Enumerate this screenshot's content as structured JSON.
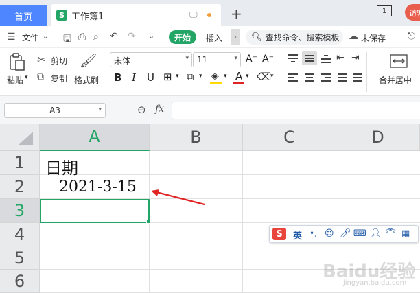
{
  "tabs": {
    "home_label": "首页",
    "doc_icon_letter": "S",
    "doc_title": "工作簿1",
    "page_indicator": "1",
    "visitor_label": "访客"
  },
  "menu": {
    "file_label": "文件",
    "start_label": "开始",
    "insert_label": "插入",
    "search_placeholder": "查找命令、搜索模板",
    "unsaved_label": "未保存"
  },
  "ribbon": {
    "paste_label": "粘贴",
    "cut_label": "剪切",
    "copy_label": "复制",
    "format_painter_label": "格式刷",
    "font_name": "宋体",
    "font_size": "11",
    "bold": "B",
    "italic": "I",
    "underline": "U",
    "merge_center_label": "合并居中"
  },
  "formula_bar": {
    "name_box": "A3",
    "fx": "fx",
    "formula": ""
  },
  "sheet": {
    "columns": [
      "A",
      "B",
      "C",
      "D"
    ],
    "rows": [
      "1",
      "2",
      "3",
      "4",
      "5",
      "6"
    ],
    "cells": {
      "A1": "日期",
      "A2": "2021-3-15"
    },
    "selected_cell": "A3"
  },
  "ime_toolbar": {
    "logo": "S",
    "lang": "英",
    "punct": "•,"
  },
  "watermark": {
    "text": "Baidu经验",
    "url": "jingyan.baidu.com"
  },
  "colors": {
    "accent_green": "#23a566",
    "home_tab_blue": "#4d86ff",
    "arrow_red": "#e02424"
  }
}
